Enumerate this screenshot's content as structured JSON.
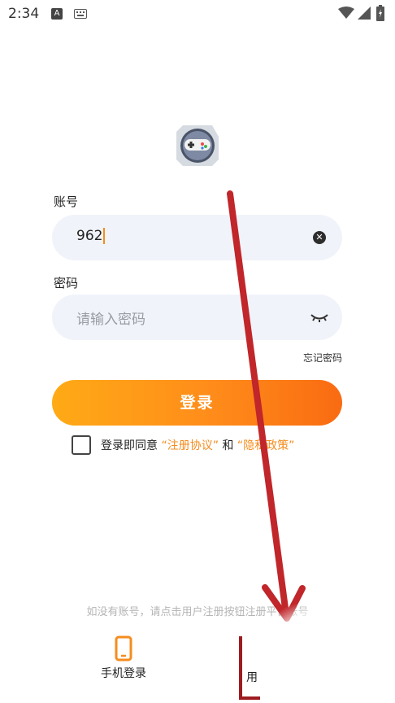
{
  "status_bar": {
    "time": "2:34",
    "a_icon": "A"
  },
  "form": {
    "account_label": "账号",
    "account_value": "962",
    "password_label": "密码",
    "password_placeholder": "请输入密码",
    "forgot_password": "忘记密码",
    "login_button": "登录"
  },
  "agreement": {
    "prefix": "登录即同意",
    "terms_link": "“注册协议”",
    "and": "和",
    "privacy_link": "“隐私政策”"
  },
  "footer": {
    "hint": "如没有账号，请点击用户注册按钮注册平台账号",
    "phone_login_label": "手机登录",
    "user_register_label": "用"
  },
  "colors": {
    "accent": "#f58c1e",
    "annotation_arrow": "#c0262a"
  }
}
